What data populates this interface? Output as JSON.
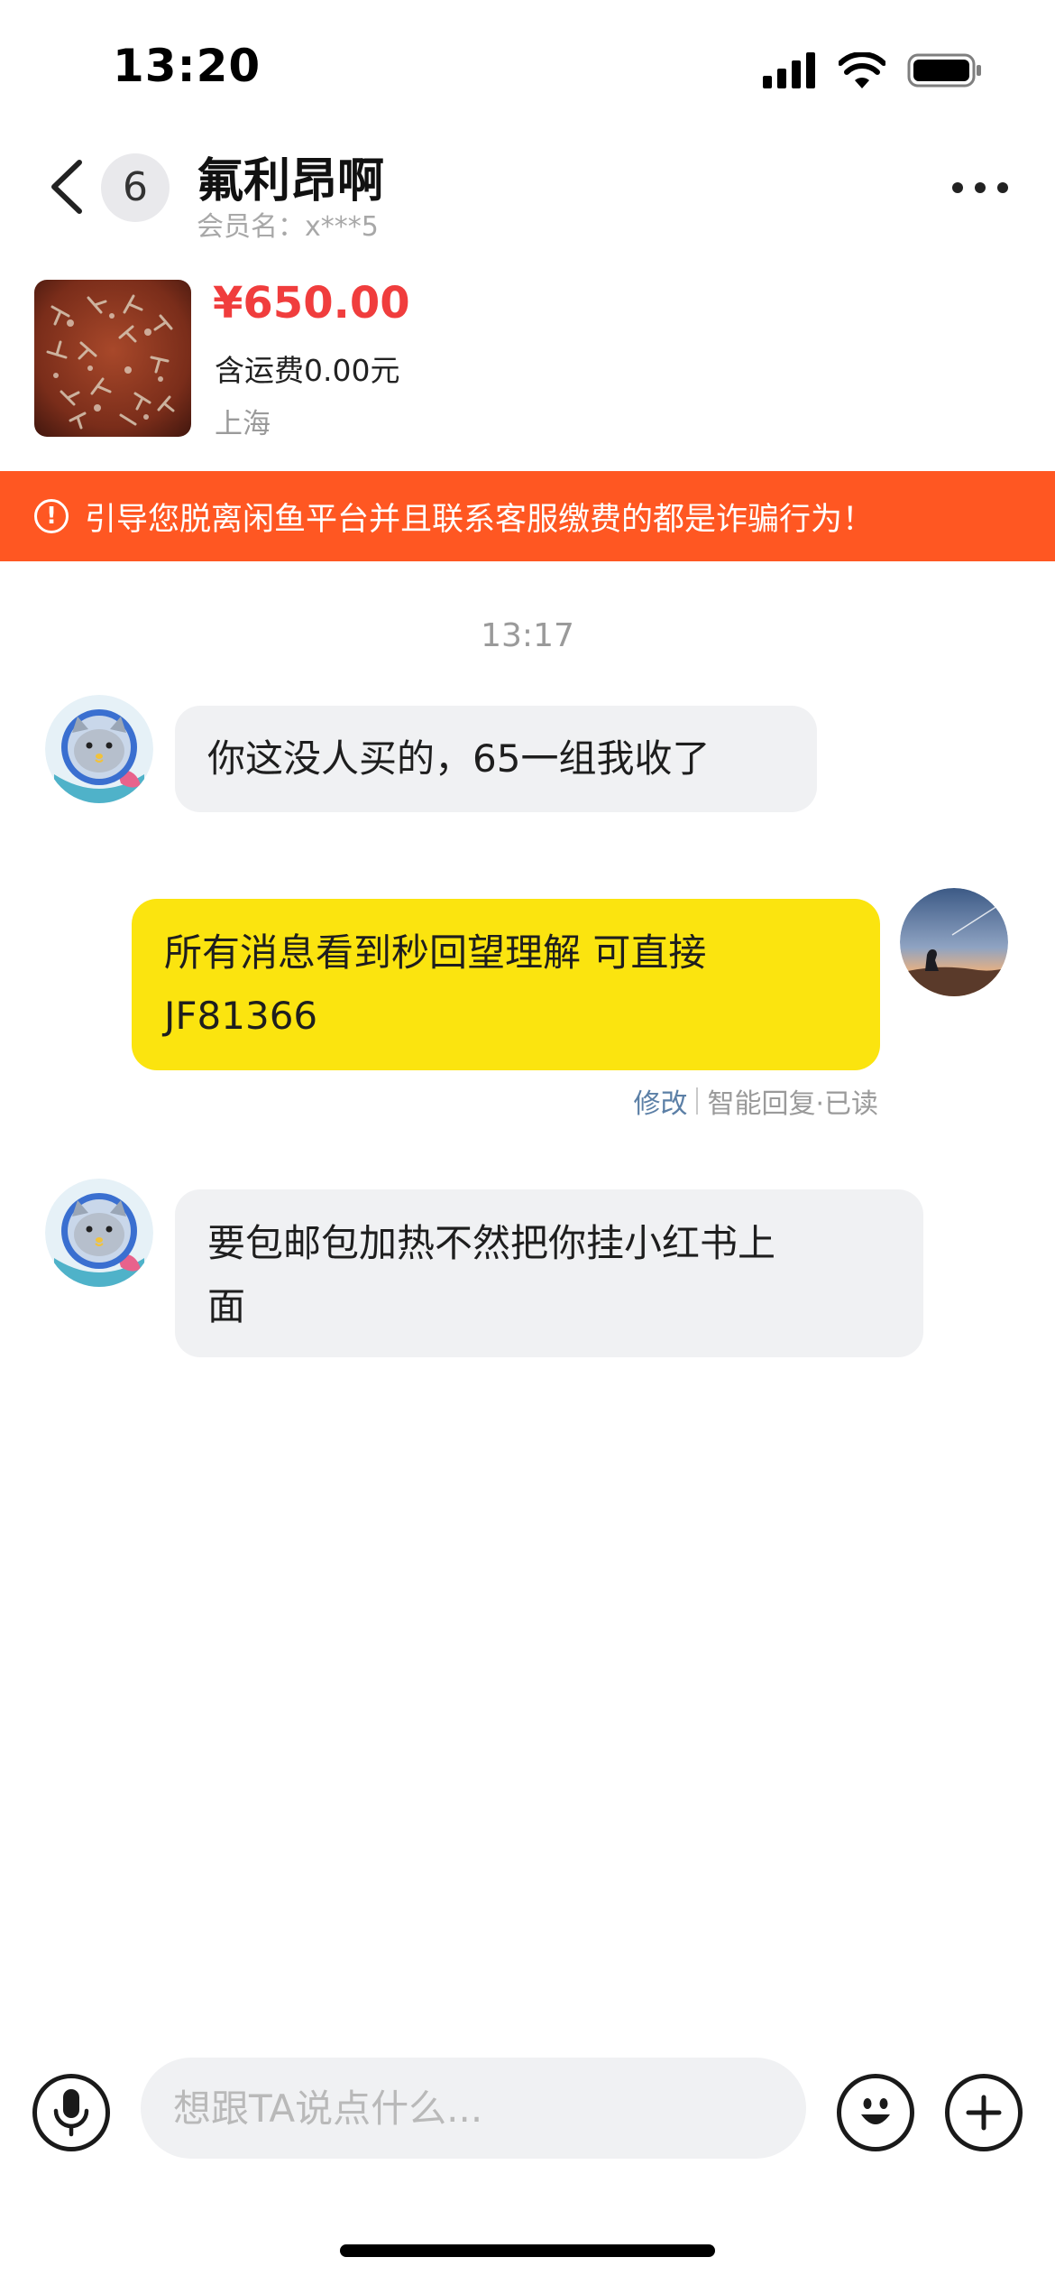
{
  "status_bar": {
    "time": "13:20",
    "icons": [
      "cellular-signal-icon",
      "wifi-icon",
      "battery-icon"
    ]
  },
  "header": {
    "back_icon": "chevron-left-icon",
    "unread_count": "6",
    "contact_name": "氟利昂啊",
    "member_label": "会员名：",
    "member_value": "x***5",
    "more_icon": "more-horizontal-icon"
  },
  "product": {
    "price": "¥650.00",
    "shipping": "含运费0.00元",
    "location": "上海"
  },
  "warning": {
    "icon": "exclamation-circle-icon",
    "text": "引导您脱离闲鱼平台并且联系客服缴费的都是诈骗行为！"
  },
  "chat": {
    "timestamp": "13:17",
    "messages": [
      {
        "direction": "incoming",
        "lines": [
          "你这没人买的，65一组我收了"
        ]
      },
      {
        "direction": "outgoing",
        "lines": [
          "所有消息看到秒回望理解  可直接",
          "JF81366"
        ]
      },
      {
        "direction": "incoming",
        "lines": [
          "要包邮包加热不然把你挂小红书上",
          "面"
        ]
      }
    ],
    "outgoing_meta": {
      "edit_label": "修改",
      "status": "智能回复·已读"
    }
  },
  "input_bar": {
    "voice_icon": "microphone-icon",
    "placeholder": "想跟TA说点什么...",
    "emoji_icon": "emoji-icon",
    "plus_icon": "plus-circle-icon"
  },
  "colors": {
    "warning_bg": "#ff5722",
    "price": "#f03d3d",
    "outgoing_bubble": "#fbe40f",
    "incoming_bubble": "#f0f1f3",
    "edit_link": "#5b7fa6"
  }
}
